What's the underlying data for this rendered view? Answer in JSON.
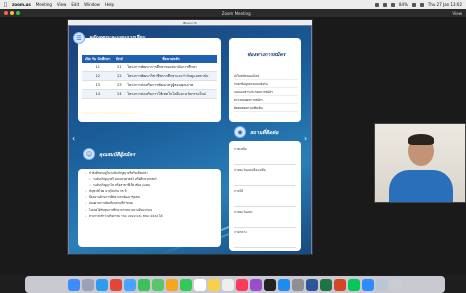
{
  "menubar": {
    "app": "zoom.us",
    "items": [
      "Meeting",
      "View",
      "Edit",
      "Window",
      "Help"
    ],
    "status_right": [
      "84%"
    ],
    "datetime": "Thu 27 Jan  13:02"
  },
  "zoom": {
    "window_title": "Zoom Meeting",
    "view_label": "View",
    "share_title": "Bhavu Hi"
  },
  "slide": {
    "left_top_header": "หลักสูตรและแผนการเรียน",
    "table_headers": [
      "เปิด รับ นักศึกษา",
      "ปักษ์",
      "ชื่อนายหลัก"
    ],
    "table_rows": [
      [
        "11",
        "21",
        "โครงการพัฒนาการศึกษาของสถาบันการศึกษา"
      ],
      [
        "12",
        "22",
        "โครงการพัฒนาวิชาชีพการศึกษาและกำกับดูแลสถาบัน"
      ],
      [
        "13",
        "23",
        "โครงการส่งเสริมการพัฒนาครูผู้สอนคุณภาพ"
      ],
      [
        "14",
        "24",
        "โครงการส่งเสริมการใช้เทคโนโลยีและนวัตกรรมใหม่"
      ]
    ],
    "note": "*หลักสูตรสามารถปรับเปลี่ยนได้ตามความเหมาะสม",
    "left_bottom_header": "คุณสมบัติผู้สมัคร",
    "qualifications": [
      "กำลังศึกษาอยู่ในระดับปริญญาตรีหรือเทียบเท่า",
      "ระดับปริญญาตรี คณะครุศาสตร์ หรือศึกษาศาสตร์",
      "ระดับปริญญาโท หรือสาขาที่เกี่ยวข้อง (GPA)",
      "สัญชาติไทย อายุไม่เกิน 35 ปี",
      "มีผลงานด้านการศึกษาและพัฒนาชุมชน",
      "สอบผ่านการคัดเลือกตามที่กำหนด",
      "ไม่เคยได้รับทุนการศึกษาจากหน่วยงานอื่นมาก่อน",
      "สามารถเข้าร่วมกิจกรรม YSC 2022 และ MSC 2022 ได้"
    ],
    "right_top_header": "ช่องทางการสมัคร",
    "right_top_lines": [
      "ส่งใบสมัครออนไลน์",
      "กรอกข้อมูลตามแบบฟอร์ม",
      "แนบเอกสารประกอบการสมัคร",
      "ตรวจสอบผลการสมัคร",
      "ติดต่อสอบถามเพิ่มเติม"
    ],
    "right_bottom_header": "สถานที่ติดต่อ",
    "contacts": [
      "ภาคเหนือ",
      "ภาคตะวันออกเฉียงเหนือ",
      "ภาคใต้",
      "ภาคตะวันออก",
      "ภาคกลาง"
    ]
  },
  "dock_icons": [
    "finder-icon",
    "launchpad-icon",
    "safari-icon",
    "chrome-icon",
    "mail-icon",
    "messages-icon",
    "maps-icon",
    "photos-icon",
    "facetime-icon",
    "calendar-icon",
    "notes-icon",
    "reminders-icon",
    "music-icon",
    "podcasts-icon",
    "tv-icon",
    "appstore-icon",
    "settings-icon",
    "word-icon",
    "excel-icon",
    "powerpoint-icon",
    "line-icon",
    "zoom-icon",
    "preview-icon",
    "trash-icon"
  ]
}
